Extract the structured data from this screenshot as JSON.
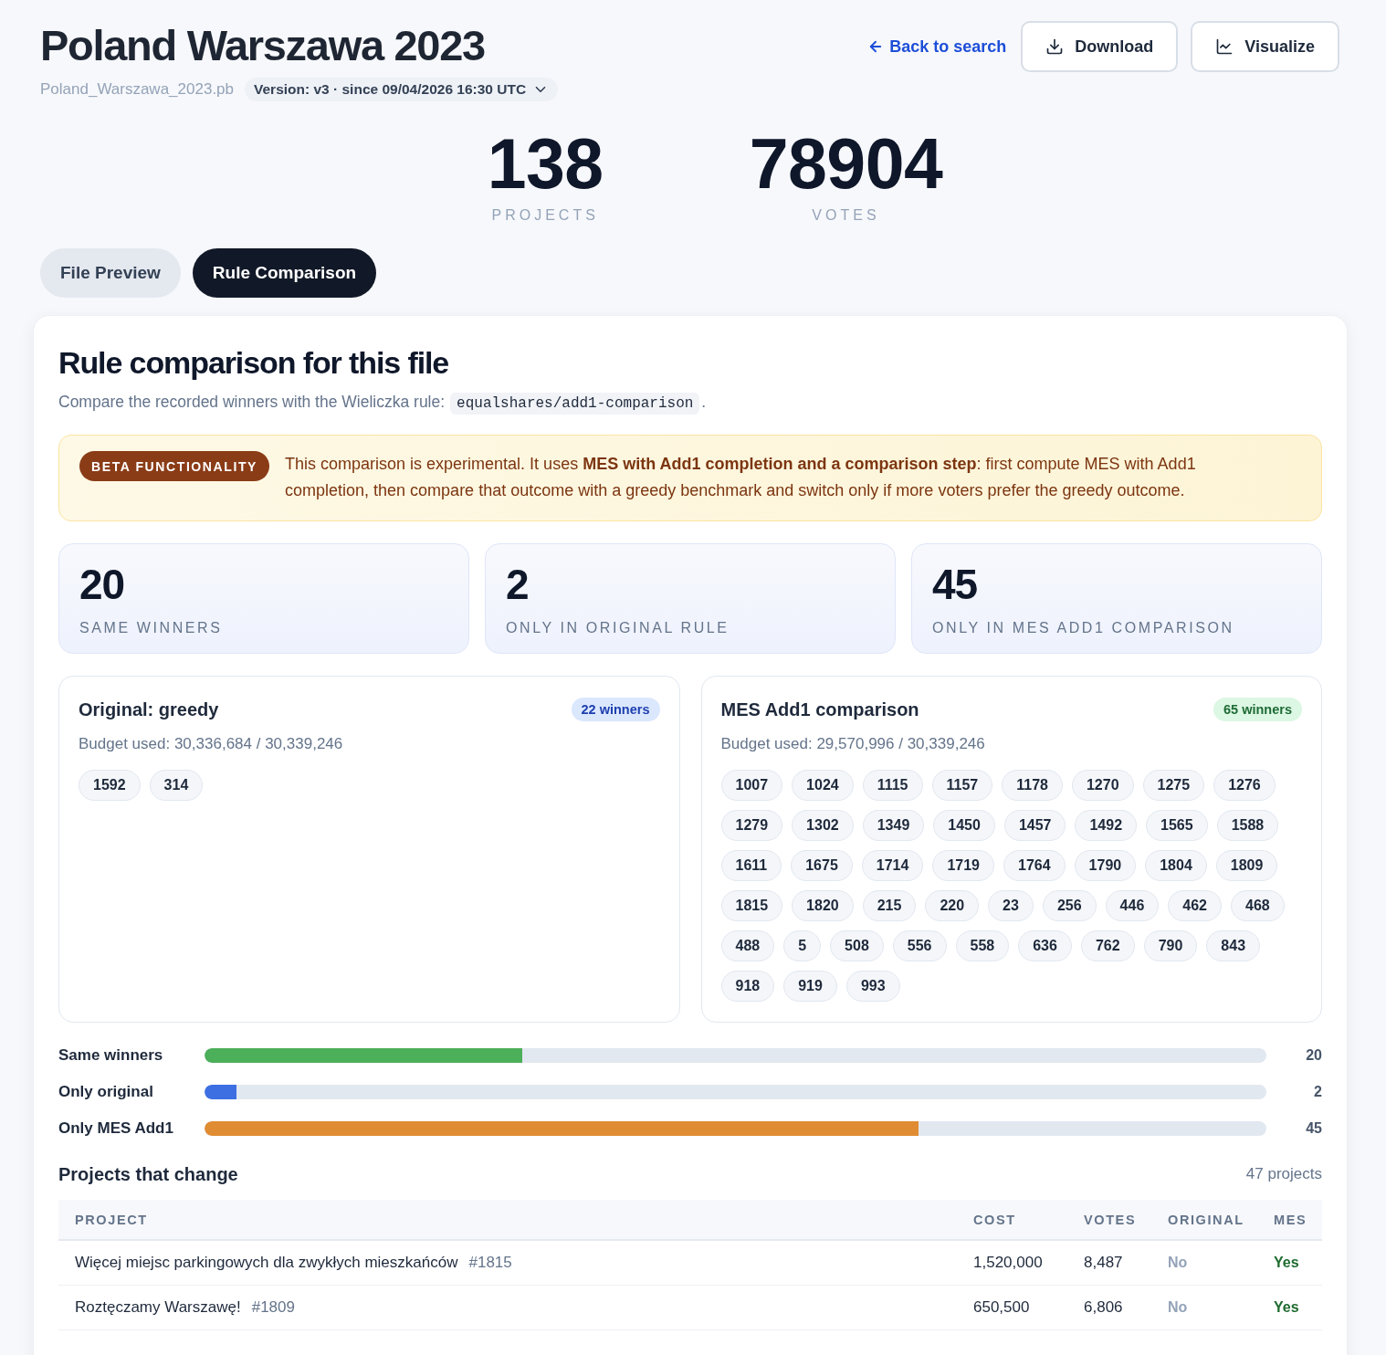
{
  "header": {
    "title": "Poland Warszawa 2023",
    "filename": "Poland_Warszawa_2023.pb",
    "version": "Version: v3 · since 09/04/2026 16:30 UTC",
    "back_link": "Back to search",
    "buttons": [
      {
        "label": "Download",
        "kind": "download"
      },
      {
        "label": "Visualize",
        "kind": "chart"
      }
    ]
  },
  "stats": [
    {
      "value": "138",
      "label": "PROJECTS"
    },
    {
      "value": "78904",
      "label": "VOTES"
    }
  ],
  "tabs": [
    {
      "label": "File Preview",
      "selected": false
    },
    {
      "label": "Rule Comparison",
      "selected": true
    }
  ],
  "comparison": {
    "title": "Rule comparison for this file",
    "description": {
      "text": "Compare the recorded winners with the Wieliczka rule:",
      "code": "equalshares/add1-comparison",
      "end": "."
    },
    "beta": {
      "badge": "BETA FUNCTIONALITY",
      "text": "This comparison is experimental. It uses **MES with Add1 completion and a comparison step**: first compute MES with Add1 completion, then compare that outcome with a greedy benchmark and switch only if more voters prefer the greedy outcome."
    },
    "summary": [
      {
        "value": "20",
        "label": "SAME WINNERS"
      },
      {
        "value": "2",
        "label": "ONLY IN ORIGINAL RULE"
      },
      {
        "value": "45",
        "label": "ONLY IN MES ADD1 COMPARISON"
      }
    ],
    "panels": [
      {
        "kind": "original",
        "title": "Original: greedy",
        "badge": "22 winners",
        "budget": "Budget used: 30,336,684 / 30,339,246",
        "projects": [
          "1592",
          "314"
        ]
      },
      {
        "kind": "mes",
        "title": "MES Add1 comparison",
        "badge": "65 winners",
        "budget": "Budget used: 29,570,996 / 30,339,246",
        "projects": [
          "1007",
          "1024",
          "1115",
          "1157",
          "1178",
          "1270",
          "1275",
          "1276",
          "1279",
          "1302",
          "1349",
          "1450",
          "1457",
          "1492",
          "1565",
          "1588",
          "1611",
          "1675",
          "1714",
          "1719",
          "1764",
          "1790",
          "1804",
          "1809",
          "1815",
          "1820",
          "215",
          "220",
          "23",
          "256",
          "446",
          "462",
          "468",
          "488",
          "5",
          "508",
          "556",
          "558",
          "636",
          "762",
          "790",
          "843",
          "918",
          "919",
          "993"
        ]
      }
    ],
    "bars": [
      {
        "label": "Same winners",
        "level": 0.299,
        "value": "20",
        "color": "#4caf5a"
      },
      {
        "label": "Only original",
        "level": 0.03,
        "value": "2",
        "color": "#3d6fe3"
      },
      {
        "label": "Only MES Add1",
        "level": 0.672,
        "value": "45",
        "color": "#e08c33"
      }
    ],
    "changes": {
      "title": "Projects that change",
      "count": "47 projects",
      "columns": [
        "PROJECT",
        "COST",
        "VOTES",
        "ORIGINAL",
        "MES"
      ],
      "rows": [
        {
          "project": "Więcej miejsc parkingowych dla zwykłych mieszkańców",
          "id": "#1815",
          "cost": "1,520,000",
          "votes": "8,487",
          "original": {
            "label": "No",
            "winner": false
          },
          "mes": {
            "label": "Yes",
            "winner": true
          }
        },
        {
          "project": "Roztęczamy Warszawę!",
          "id": "#1809",
          "cost": "650,500",
          "votes": "6,806",
          "original": {
            "label": "No",
            "winner": false
          },
          "mes": {
            "label": "Yes",
            "winner": true
          }
        }
      ]
    }
  }
}
